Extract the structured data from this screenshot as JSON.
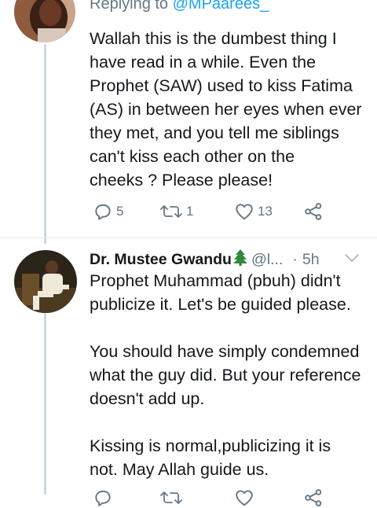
{
  "reply_tweet": {
    "replying_prefix": "Replying to",
    "replying_handle": "@MPaarees_",
    "text": "Wallah this is the dumbest thing I\nhave read in a while. Even the\nProphet (SAW) used to kiss Fatima\n(AS) in between her eyes when ever\nthey met, and you tell me siblings\ncan't kiss each other on the\ncheeks ? Please please!",
    "reply_count": "5",
    "retweet_count": "1",
    "like_count": "13"
  },
  "second_tweet": {
    "display_name": "Dr. Mustee Gwandu",
    "handle": "@l...",
    "separator": "·",
    "time": "5h",
    "text": "Prophet Muhammad (pbuh) didn't\npublicize it. Let's be guided please.\n\nYou should have simply condemned\nwhat the guy did. But your reference\ndoesn't add up.\n\nKissing is normal,publicizing it is\nnot. May Allah guide us."
  },
  "icons": {
    "reply": "reply-icon",
    "retweet": "retweet-icon",
    "like": "heart-icon",
    "share": "share-icon",
    "more": "chevron-down-icon",
    "emoji": "christmas-tree-emoji"
  },
  "colors": {
    "text": "#14171a",
    "secondary": "#657786",
    "link": "#1da1f2",
    "thread_line": "#ccd6dd",
    "divider": "#e6ecf0",
    "tree_green": "#2e8b3a"
  }
}
